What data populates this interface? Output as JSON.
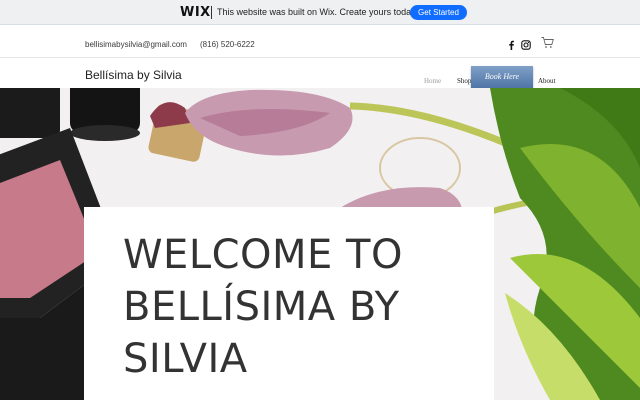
{
  "wix_banner": {
    "logo": "WIX",
    "message": "This website was built on Wix. Create yours today.",
    "cta": "Get Started"
  },
  "contact": {
    "email": "bellisimabysilvia@gmail.com",
    "phone": "(816) 520-6222"
  },
  "header": {
    "brand": "Bellísima by Silvia",
    "nav": [
      "Home",
      "Shop",
      "About"
    ],
    "book_button": "Book Here",
    "icons": [
      "facebook-icon",
      "instagram-icon",
      "cart-icon"
    ]
  },
  "hero": {
    "heading": "WELCOME TO BELLÍSIMA BY SILVIA"
  },
  "colors": {
    "wix_blue": "#116dff",
    "book_button": "#5a7fb0",
    "text": "#333333"
  }
}
